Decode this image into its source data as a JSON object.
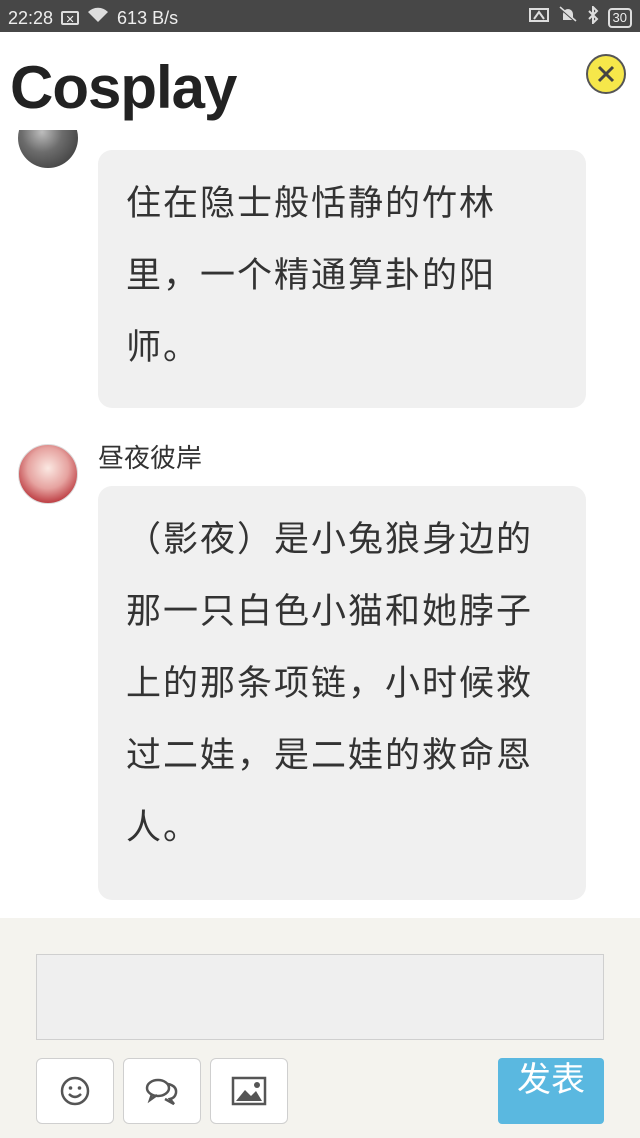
{
  "status_bar": {
    "time": "22:28",
    "net_speed": "613 B/s",
    "battery": "30",
    "notif_glyph": "✕"
  },
  "header": {
    "title": "Cosplay"
  },
  "messages": [
    {
      "sender": "",
      "text": "住在隐士般恬静的竹林里，一个精通算卦的阳师。"
    },
    {
      "sender": "昼夜彼岸",
      "text": "（影夜）是小兔狼身边的那一只白色小猫和她脖子上的那条项链，小时候救过二娃，是二娃的救命恩人。"
    }
  ],
  "composer": {
    "input_value": "",
    "send_label": "发表"
  },
  "icons": {
    "close": "close-icon",
    "emoji": "smiley-icon",
    "chat": "chat-bubbles-icon",
    "image": "image-icon"
  },
  "colors": {
    "status_bar": "#474747",
    "close_button": "#f6e74a",
    "bubble": "#f0f0f0",
    "send_button": "#5ab8e0",
    "composer_bg": "#f4f3ee"
  }
}
